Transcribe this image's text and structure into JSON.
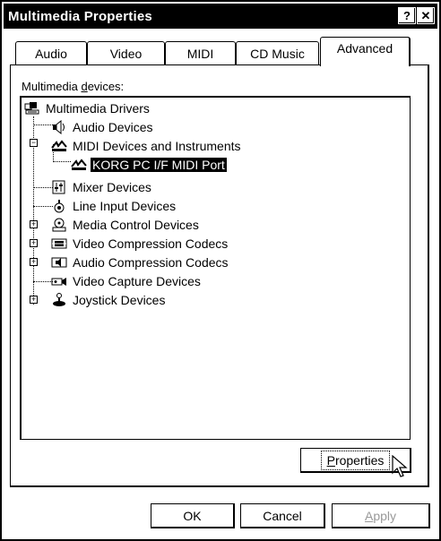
{
  "window": {
    "title": "Multimedia Properties",
    "help_label": "?",
    "close_label": "✕"
  },
  "tabs": [
    {
      "label": "Audio",
      "active": false
    },
    {
      "label": "Video",
      "active": false
    },
    {
      "label": "MIDI",
      "active": false
    },
    {
      "label": "CD Music",
      "active": false
    },
    {
      "label": "Advanced",
      "active": true
    }
  ],
  "advanced": {
    "group_label_prefix": "Multimedia ",
    "group_label_mnemonic": "d",
    "group_label_suffix": "evices:",
    "tree": [
      {
        "label": "Multimedia Drivers",
        "icon": "multimedia-drivers-icon",
        "level": 0,
        "expander": "none",
        "selected": false
      },
      {
        "label": "Audio Devices",
        "icon": "speaker-icon",
        "level": 1,
        "expander": "none",
        "selected": false
      },
      {
        "label": "MIDI Devices and Instruments",
        "icon": "midi-icon",
        "level": 1,
        "expander": "minus",
        "selected": false
      },
      {
        "label": "KORG PC I/F MIDI Port",
        "icon": "midi-icon",
        "level": 2,
        "expander": "none",
        "selected": true
      },
      {
        "label": "Mixer Devices",
        "icon": "mixer-icon",
        "level": 1,
        "expander": "none",
        "selected": false
      },
      {
        "label": "Line Input Devices",
        "icon": "line-input-icon",
        "level": 1,
        "expander": "none",
        "selected": false
      },
      {
        "label": "Media Control Devices",
        "icon": "media-control-icon",
        "level": 1,
        "expander": "plus",
        "selected": false
      },
      {
        "label": "Video Compression Codecs",
        "icon": "video-codec-icon",
        "level": 1,
        "expander": "plus",
        "selected": false
      },
      {
        "label": "Audio Compression Codecs",
        "icon": "audio-codec-icon",
        "level": 1,
        "expander": "plus",
        "selected": false
      },
      {
        "label": "Video Capture Devices",
        "icon": "video-capture-icon",
        "level": 1,
        "expander": "none",
        "selected": false
      },
      {
        "label": "Joystick Devices",
        "icon": "joystick-icon",
        "level": 1,
        "expander": "plus",
        "selected": false
      }
    ],
    "properties_mnemonic": "P",
    "properties_rest": "roperties"
  },
  "footer": {
    "ok_label": "OK",
    "cancel_label": "Cancel",
    "apply_mnemonic": "A",
    "apply_rest": "pply"
  }
}
